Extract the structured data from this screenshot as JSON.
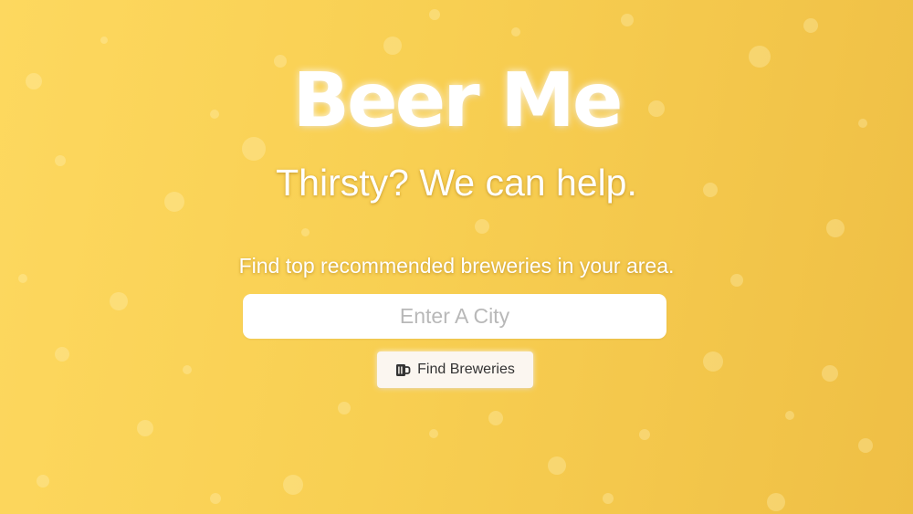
{
  "hero": {
    "title": "Beer Me",
    "tagline": "Thirsty? We can help.",
    "subtitle": "Find top recommended breweries in your area."
  },
  "search": {
    "placeholder": "Enter A City",
    "value": ""
  },
  "find_button": {
    "label": "Find Breweries",
    "icon": "beer-mug-icon"
  },
  "colors": {
    "background_start": "#fdd85f",
    "background_end": "#efbf45",
    "text": "#ffffff",
    "button_background": "#fbf6f0"
  }
}
